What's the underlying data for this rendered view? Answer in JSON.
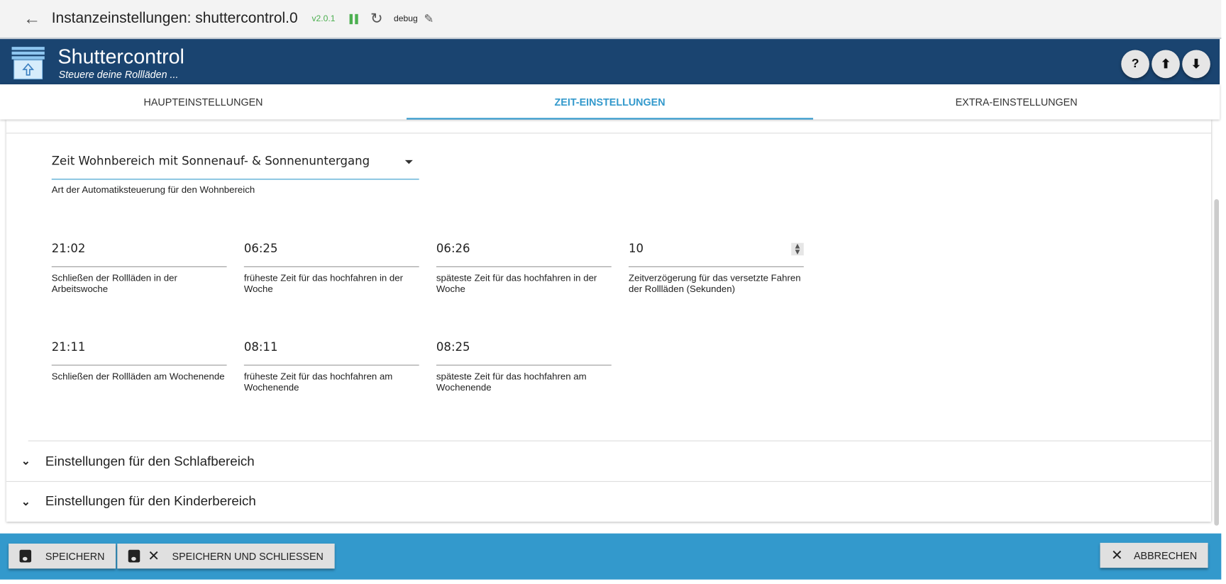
{
  "topbar": {
    "title": "Instanzeinstellungen: shuttercontrol.0",
    "version": "v2.0.1",
    "log_level": "debug"
  },
  "header": {
    "name": "Shuttercontrol",
    "subtitle": "Steuere deine Rollläden ..."
  },
  "tabs": [
    {
      "label": "HAUPTEINSTELLUNGEN",
      "active": false
    },
    {
      "label": "ZEIT-EINSTELLUNGEN",
      "active": true
    },
    {
      "label": "EXTRA-EINSTELLUNGEN",
      "active": false
    }
  ],
  "living": {
    "mode_select": {
      "value": "Zeit Wohnbereich mit Sonnenauf- & Sonnenuntergang",
      "help": "Art der Automatiksteuerung für den Wohnbereich"
    },
    "fields": [
      {
        "value": "21:02",
        "help": "Schließen der Rollläden in der Arbeitswoche"
      },
      {
        "value": "06:25",
        "help": "früheste Zeit für das hochfahren in der Woche"
      },
      {
        "value": "06:26",
        "help": "späteste Zeit für das hochfahren in der Woche"
      },
      {
        "value": "10",
        "help": "Zeitverzögerung für das versetzte Fahren der Rollläden (Sekunden)"
      },
      {
        "value": "21:11",
        "help": "Schließen der Rollläden am Wochenende"
      },
      {
        "value": "08:11",
        "help": "früheste Zeit für das hochfahren am Wochenende"
      },
      {
        "value": "08:25",
        "help": "späteste Zeit für das hochfahren am Wochenende"
      }
    ]
  },
  "sections": [
    {
      "label": "Einstellungen für den Schlafbereich"
    },
    {
      "label": "Einstellungen für den Kinderbereich"
    }
  ],
  "footer": {
    "save": "SPEICHERN",
    "save_close": "SPEICHERN UND SCHLIESSEN",
    "cancel": "ABBRECHEN"
  },
  "colors": {
    "header": "#1a4470",
    "accent": "#3399cc",
    "running": "#4caf50"
  }
}
